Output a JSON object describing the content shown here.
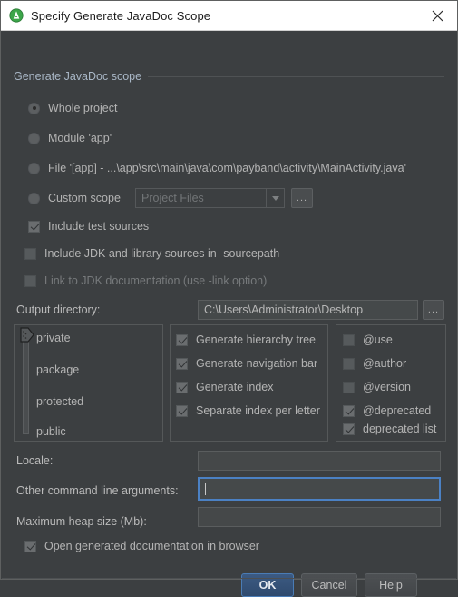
{
  "window": {
    "title": "Specify Generate JavaDoc Scope",
    "icon": "android-studio-icon",
    "close_label": "close-icon"
  },
  "group": {
    "legend": "Generate JavaDoc scope"
  },
  "scope": {
    "options": [
      {
        "label": "Whole project",
        "selected": true
      },
      {
        "label": "Module 'app'",
        "selected": false
      },
      {
        "label": "File '[app] - ...\\app\\src\\main\\java\\com\\payband\\activity\\MainActivity.java'",
        "selected": false
      },
      {
        "label": "Custom scope",
        "selected": false
      }
    ],
    "custom_scope_combo": {
      "value": "Project Files",
      "enabled": false,
      "browse_label": "..."
    }
  },
  "options": {
    "include_test_sources": {
      "label": "Include test sources",
      "checked": true,
      "enabled": true
    },
    "include_jdk_sources": {
      "label": "Include JDK and library sources in -sourcepath",
      "checked": false,
      "enabled": true
    },
    "link_jdk_doc": {
      "label": "Link to JDK documentation (use -link option)",
      "checked": false,
      "enabled": false
    }
  },
  "output_directory": {
    "label": "Output directory:",
    "value": "C:\\Users\\Administrator\\Desktop",
    "browse_label": "..."
  },
  "visibility_slider": {
    "levels": [
      "private",
      "package",
      "protected",
      "public"
    ],
    "selected": "private"
  },
  "generate_options": [
    {
      "label": "Generate hierarchy tree",
      "checked": true
    },
    {
      "label": "Generate navigation bar",
      "checked": true
    },
    {
      "label": "Generate index",
      "checked": true
    },
    {
      "label": "Separate index per letter",
      "checked": true
    }
  ],
  "tag_options": [
    {
      "label": "@use",
      "checked": false
    },
    {
      "label": "@author",
      "checked": false
    },
    {
      "label": "@version",
      "checked": false
    },
    {
      "label": "@deprecated",
      "checked": true
    },
    {
      "label": "deprecated list",
      "checked": true
    }
  ],
  "fields": {
    "locale": {
      "label": "Locale:",
      "value": "",
      "focused": false
    },
    "other_args": {
      "label": "Other command line arguments:",
      "value": "",
      "focused": true
    },
    "max_heap": {
      "label": "Maximum heap size (Mb):",
      "value": "",
      "focused": false
    }
  },
  "open_in_browser": {
    "label": "Open generated documentation in browser",
    "checked": true
  },
  "buttons": {
    "ok": "OK",
    "cancel": "Cancel",
    "help": "Help"
  },
  "colors": {
    "background": "#3c3f41",
    "titlebar": "#ffffff",
    "accent": "#4b81c4",
    "text": "#b4b4b4"
  }
}
